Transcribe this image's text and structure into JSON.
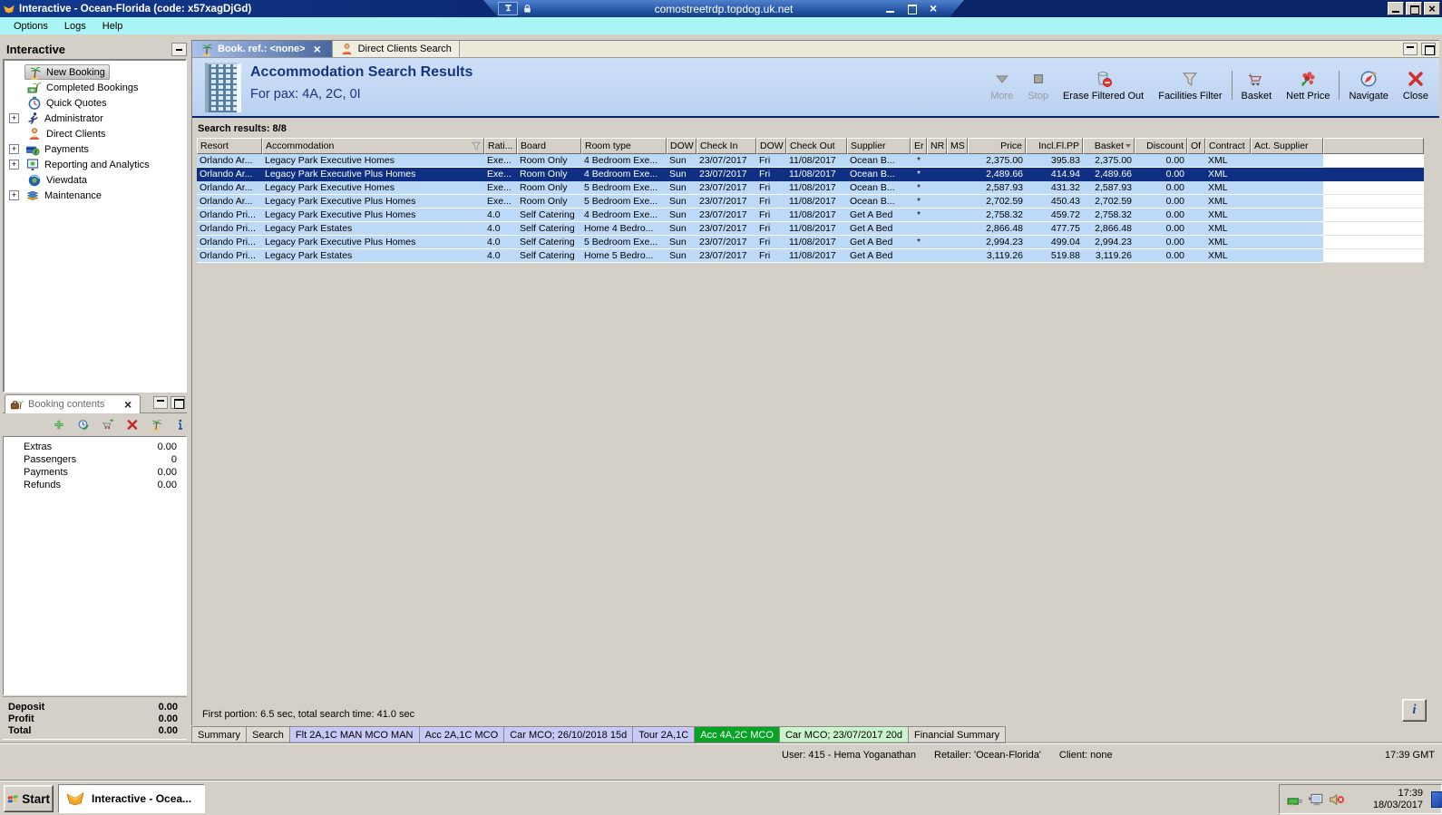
{
  "window": {
    "title": "Interactive - Ocean-Florida (code: x57xagDjGd)"
  },
  "rdp_bar": {
    "host": "comostreetrdp.topdog.uk.net"
  },
  "menu": {
    "items": [
      "Options",
      "Logs",
      "Help"
    ]
  },
  "sidebar": {
    "title": "Interactive",
    "items": [
      {
        "label": "New Booking",
        "icon": "palm",
        "selected": true,
        "expandable": false
      },
      {
        "label": "Completed Bookings",
        "icon": "completed",
        "expandable": false
      },
      {
        "label": "Quick Quotes",
        "icon": "clock",
        "expandable": false
      },
      {
        "label": "Administrator",
        "icon": "runner",
        "expandable": true
      },
      {
        "label": "Direct Clients",
        "icon": "person",
        "expandable": false
      },
      {
        "label": "Payments",
        "icon": "payments",
        "expandable": true
      },
      {
        "label": "Reporting and Analytics",
        "icon": "report",
        "expandable": true
      },
      {
        "label": "Viewdata",
        "icon": "globe",
        "expandable": false
      },
      {
        "label": "Maintenance",
        "icon": "books",
        "expandable": true
      }
    ]
  },
  "booking_contents": {
    "title": "Booking contents",
    "toolbar_icons": [
      "add",
      "refresh",
      "cart-arrow",
      "delete",
      "palm",
      "info"
    ],
    "rows": [
      {
        "label": "Extras",
        "value": "0.00"
      },
      {
        "label": "Passengers",
        "value": "0"
      },
      {
        "label": "Payments",
        "value": "0.00"
      },
      {
        "label": "Refunds",
        "value": "0.00"
      }
    ],
    "summary": [
      {
        "label": "Deposit",
        "value": "0.00"
      },
      {
        "label": "Profit",
        "value": "0.00"
      },
      {
        "label": "Total",
        "value": "0.00"
      }
    ]
  },
  "tabs": [
    {
      "label": "Book. ref.: <none>",
      "icon": "palm",
      "active": true,
      "closable": true
    },
    {
      "label": "Direct Clients Search",
      "icon": "person",
      "active": false,
      "closable": false
    }
  ],
  "results_header": {
    "title": "Accommodation Search Results",
    "subtitle": "For pax: 4A, 2C, 0I"
  },
  "toolbar": {
    "buttons": [
      {
        "label": "More",
        "icon": "more",
        "disabled": true
      },
      {
        "label": "Stop",
        "icon": "stop",
        "disabled": true
      },
      {
        "label": "Erase Filtered Out",
        "icon": "erase"
      },
      {
        "label": "Facilities Filter",
        "icon": "funnel",
        "sep_after": true
      },
      {
        "label": "Basket",
        "icon": "basket"
      },
      {
        "label": "Nett Price",
        "icon": "nett",
        "sep_after": true
      },
      {
        "label": "Navigate",
        "icon": "navigate"
      },
      {
        "label": "Close",
        "icon": "closex"
      }
    ]
  },
  "search_results": {
    "label": "Search results: 8/8",
    "columns": [
      {
        "label": "Resort"
      },
      {
        "label": "Accommodation",
        "filter": true
      },
      {
        "label": "Rati..."
      },
      {
        "label": "Board"
      },
      {
        "label": "Room type"
      },
      {
        "label": "DOW"
      },
      {
        "label": "Check In"
      },
      {
        "label": "DOW"
      },
      {
        "label": "Check Out"
      },
      {
        "label": "Supplier"
      },
      {
        "label": "Er"
      },
      {
        "label": "NR"
      },
      {
        "label": "MS"
      },
      {
        "label": "Price",
        "align": "right"
      },
      {
        "label": "Incl.Fl.PP",
        "align": "right"
      },
      {
        "label": "Basket",
        "align": "right",
        "sort": true
      },
      {
        "label": "Discount",
        "align": "right"
      },
      {
        "label": "Of"
      },
      {
        "label": "Contract"
      },
      {
        "label": "Act. Supplier"
      }
    ],
    "selected_row_index": 1,
    "rows": [
      [
        "Orlando Ar...",
        "Legacy Park Executive Homes",
        "Exe...",
        "Room Only",
        "4 Bedroom Exe...",
        "Sun",
        "23/07/2017",
        "Fri",
        "11/08/2017",
        "Ocean B...",
        "*",
        "",
        "",
        "2,375.00",
        "395.83",
        "2,375.00",
        "0.00",
        "",
        "XML",
        ""
      ],
      [
        "Orlando Ar...",
        "Legacy Park Executive Plus Homes",
        "Exe...",
        "Room Only",
        "4 Bedroom Exe...",
        "Sun",
        "23/07/2017",
        "Fri",
        "11/08/2017",
        "Ocean B...",
        "*",
        "",
        "",
        "2,489.66",
        "414.94",
        "2,489.66",
        "0.00",
        "",
        "XML",
        ""
      ],
      [
        "Orlando Ar...",
        "Legacy Park Executive Homes",
        "Exe...",
        "Room Only",
        "5 Bedroom Exe...",
        "Sun",
        "23/07/2017",
        "Fri",
        "11/08/2017",
        "Ocean B...",
        "*",
        "",
        "",
        "2,587.93",
        "431.32",
        "2,587.93",
        "0.00",
        "",
        "XML",
        ""
      ],
      [
        "Orlando Ar...",
        "Legacy Park Executive Plus Homes",
        "Exe...",
        "Room Only",
        "5 Bedroom Exe...",
        "Sun",
        "23/07/2017",
        "Fri",
        "11/08/2017",
        "Ocean B...",
        "*",
        "",
        "",
        "2,702.59",
        "450.43",
        "2,702.59",
        "0.00",
        "",
        "XML",
        ""
      ],
      [
        "Orlando Pri...",
        "Legacy Park Executive Plus Homes",
        "4.0",
        "Self Catering",
        "4 Bedroom Exe...",
        "Sun",
        "23/07/2017",
        "Fri",
        "11/08/2017",
        "Get A Bed",
        "*",
        "",
        "",
        "2,758.32",
        "459.72",
        "2,758.32",
        "0.00",
        "",
        "XML",
        ""
      ],
      [
        "Orlando Pri...",
        "Legacy Park Estates",
        "4.0",
        "Self Catering",
        "Home 4 Bedro...",
        "Sun",
        "23/07/2017",
        "Fri",
        "11/08/2017",
        "Get A Bed",
        "",
        "",
        "",
        "2,866.48",
        "477.75",
        "2,866.48",
        "0.00",
        "",
        "XML",
        ""
      ],
      [
        "Orlando Pri...",
        "Legacy Park Executive Plus Homes",
        "4.0",
        "Self Catering",
        "5 Bedroom Exe...",
        "Sun",
        "23/07/2017",
        "Fri",
        "11/08/2017",
        "Get A Bed",
        "*",
        "",
        "",
        "2,994.23",
        "499.04",
        "2,994.23",
        "0.00",
        "",
        "XML",
        ""
      ],
      [
        "Orlando Pri...",
        "Legacy Park Estates",
        "4.0",
        "Self Catering",
        "Home 5 Bedro...",
        "Sun",
        "23/07/2017",
        "Fri",
        "11/08/2017",
        "Get A Bed",
        "",
        "",
        "",
        "3,119.26",
        "519.88",
        "3,119.26",
        "0.00",
        "",
        "XML",
        ""
      ]
    ]
  },
  "footer": {
    "search_time": "First portion: 6.5 sec, total search time: 41.0 sec"
  },
  "bottom_tabs": [
    {
      "label": "Summary",
      "type": "plain"
    },
    {
      "label": "Search",
      "type": "plain"
    },
    {
      "label": "Flt 2A,1C MAN MCO MAN",
      "type": "blue"
    },
    {
      "label": "Acc 2A,1C MCO",
      "type": "blue"
    },
    {
      "label": "Car MCO; 26/10/2018 15d",
      "type": "blue"
    },
    {
      "label": "Tour 2A,1C",
      "type": "blue"
    },
    {
      "label": "Acc 4A,2C MCO",
      "type": "green"
    },
    {
      "label": "Car MCO; 23/07/2017 20d",
      "type": "lightgreen"
    },
    {
      "label": "Financial Summary",
      "type": "plain"
    }
  ],
  "status_bar": {
    "segments": [
      "User: 415 - Hema Yoganathan",
      "Retailer: 'Ocean-Florida'",
      "Client: none"
    ],
    "time": "17:39 GMT"
  },
  "taskbar": {
    "start_label": "Start",
    "task_label": "Interactive - Ocea...",
    "tray_time": "17:39",
    "tray_date": "18/03/2017"
  }
}
